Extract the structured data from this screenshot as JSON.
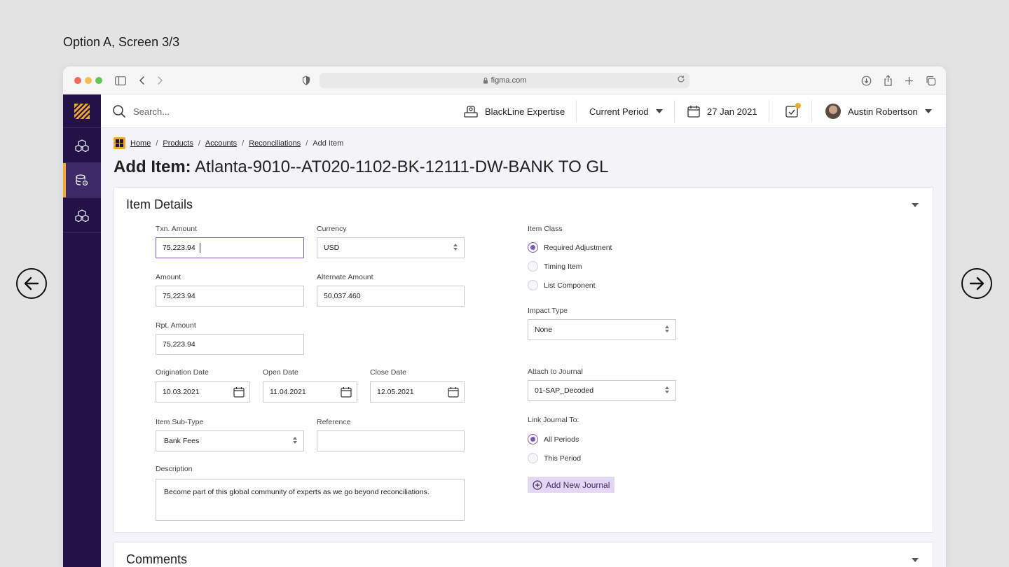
{
  "caption": "Option A, Screen 3/3",
  "browser": {
    "url": "figma.com"
  },
  "topbar": {
    "search_placeholder": "Search...",
    "expertise_label": "BlackLine Expertise",
    "period_label": "Current Period",
    "date_label": "27 Jan 2021",
    "user_name": "Austin Robertson"
  },
  "breadcrumb": {
    "items": [
      "Home",
      "Products",
      "Accounts",
      "Reconciliations"
    ],
    "current": "Add Item",
    "separator": "/"
  },
  "page_title": {
    "prefix": "Add Item:",
    "name": "Atlanta-9010--AT020-1102-BK-12111-DW-BANK TO GL"
  },
  "item_details": {
    "title": "Item Details",
    "txn_amount": {
      "label": "Txn. Amount",
      "value": "75,223.94"
    },
    "currency": {
      "label": "Currency",
      "value": "USD"
    },
    "amount": {
      "label": "Amount",
      "value": "75,223.94"
    },
    "alternate_amount": {
      "label": "Alternate Amount",
      "value": "50,037.460"
    },
    "rpt_amount": {
      "label": "Rpt. Amount",
      "value": "75,223.94"
    },
    "origination_date": {
      "label": "Origination Date",
      "value": "10.03.2021"
    },
    "open_date": {
      "label": "Open Date",
      "value": "11.04.2021"
    },
    "close_date": {
      "label": "Close Date",
      "value": "12.05.2021"
    },
    "item_sub_type": {
      "label": "Item Sub-Type",
      "value": "Bank Fees"
    },
    "reference": {
      "label": "Reference",
      "value": ""
    },
    "description": {
      "label": "Description",
      "value": "Become part of this global community of experts as we go beyond reconciliations."
    },
    "item_class": {
      "label": "Item Class",
      "options": [
        "Required Adjustment",
        "Timing Item",
        "List Component"
      ],
      "selected": "Required Adjustment"
    },
    "impact_type": {
      "label": "Impact Type",
      "value": "None"
    },
    "attach_to_journal": {
      "label": "Attach to Journal",
      "value": "01-SAP_Decoded"
    },
    "link_journal_to": {
      "label": "Link Journal To:",
      "options": [
        "All Periods",
        "This Period"
      ],
      "selected": "All Periods"
    },
    "add_new_journal": "Add New Journal"
  },
  "comments": {
    "title": "Comments"
  },
  "colors": {
    "sidebar": "#231247",
    "accent": "#f0a830",
    "primary": "#7a5bb0",
    "button_bg": "#e3d7f3"
  }
}
